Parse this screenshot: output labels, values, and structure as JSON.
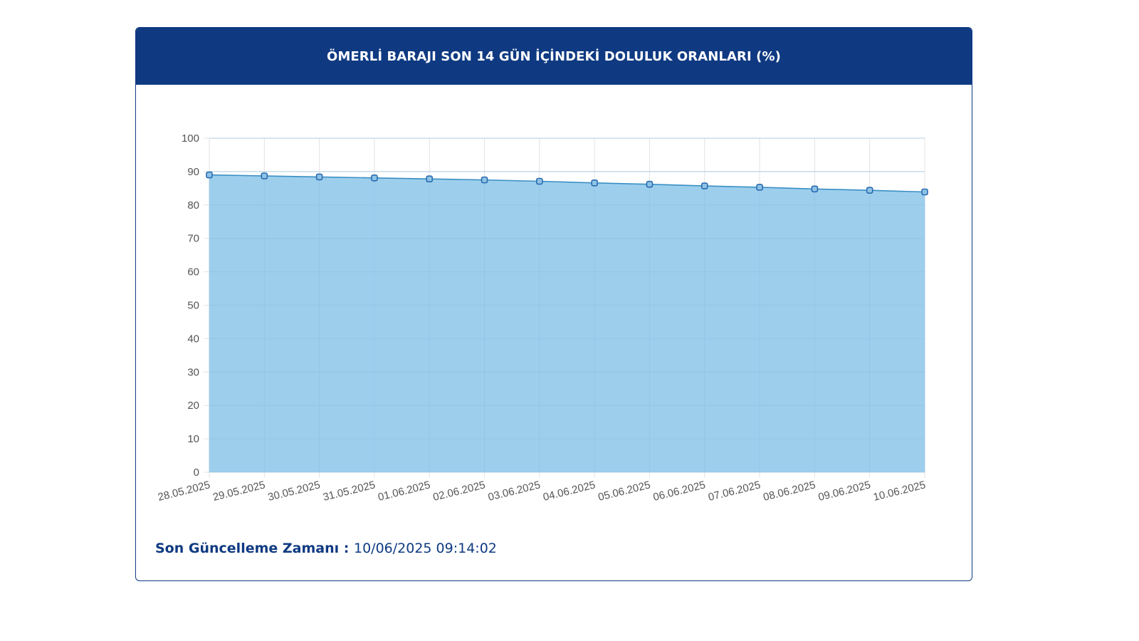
{
  "header": {
    "title": "ÖMERLİ BARAJI SON 14 GÜN İÇİNDEKİ DOLULUK ORANLARI (%)"
  },
  "footer": {
    "label": "Son Güncelleme Zamanı",
    "separator": " : ",
    "value": "10/06/2025 09:14:02"
  },
  "colors": {
    "header_bg": "#0f3a82",
    "area_fill": "#9dcfed",
    "line": "#3a8fc4",
    "marker": "#2b6cb0"
  },
  "chart_data": {
    "type": "area",
    "title": "ÖMERLİ BARAJI SON 14 GÜN İÇİNDEKİ DOLULUK ORANLARI (%)",
    "xlabel": "",
    "ylabel": "",
    "ylim": [
      0,
      100
    ],
    "yticks": [
      "0",
      "10",
      "20",
      "30",
      "40",
      "50",
      "60",
      "70",
      "80",
      "90",
      "100"
    ],
    "grid": true,
    "legend": "none",
    "categories": [
      "28.05.2025",
      "29.05.2025",
      "30.05.2025",
      "31.05.2025",
      "01.06.2025",
      "02.06.2025",
      "03.06.2025",
      "04.06.2025",
      "05.06.2025",
      "06.06.2025",
      "07.06.2025",
      "08.06.2025",
      "09.06.2025",
      "10.06.2025"
    ],
    "values": [
      89.0,
      88.7,
      88.4,
      88.1,
      87.8,
      87.5,
      87.1,
      86.6,
      86.2,
      85.7,
      85.3,
      84.8,
      84.4,
      83.9
    ]
  }
}
